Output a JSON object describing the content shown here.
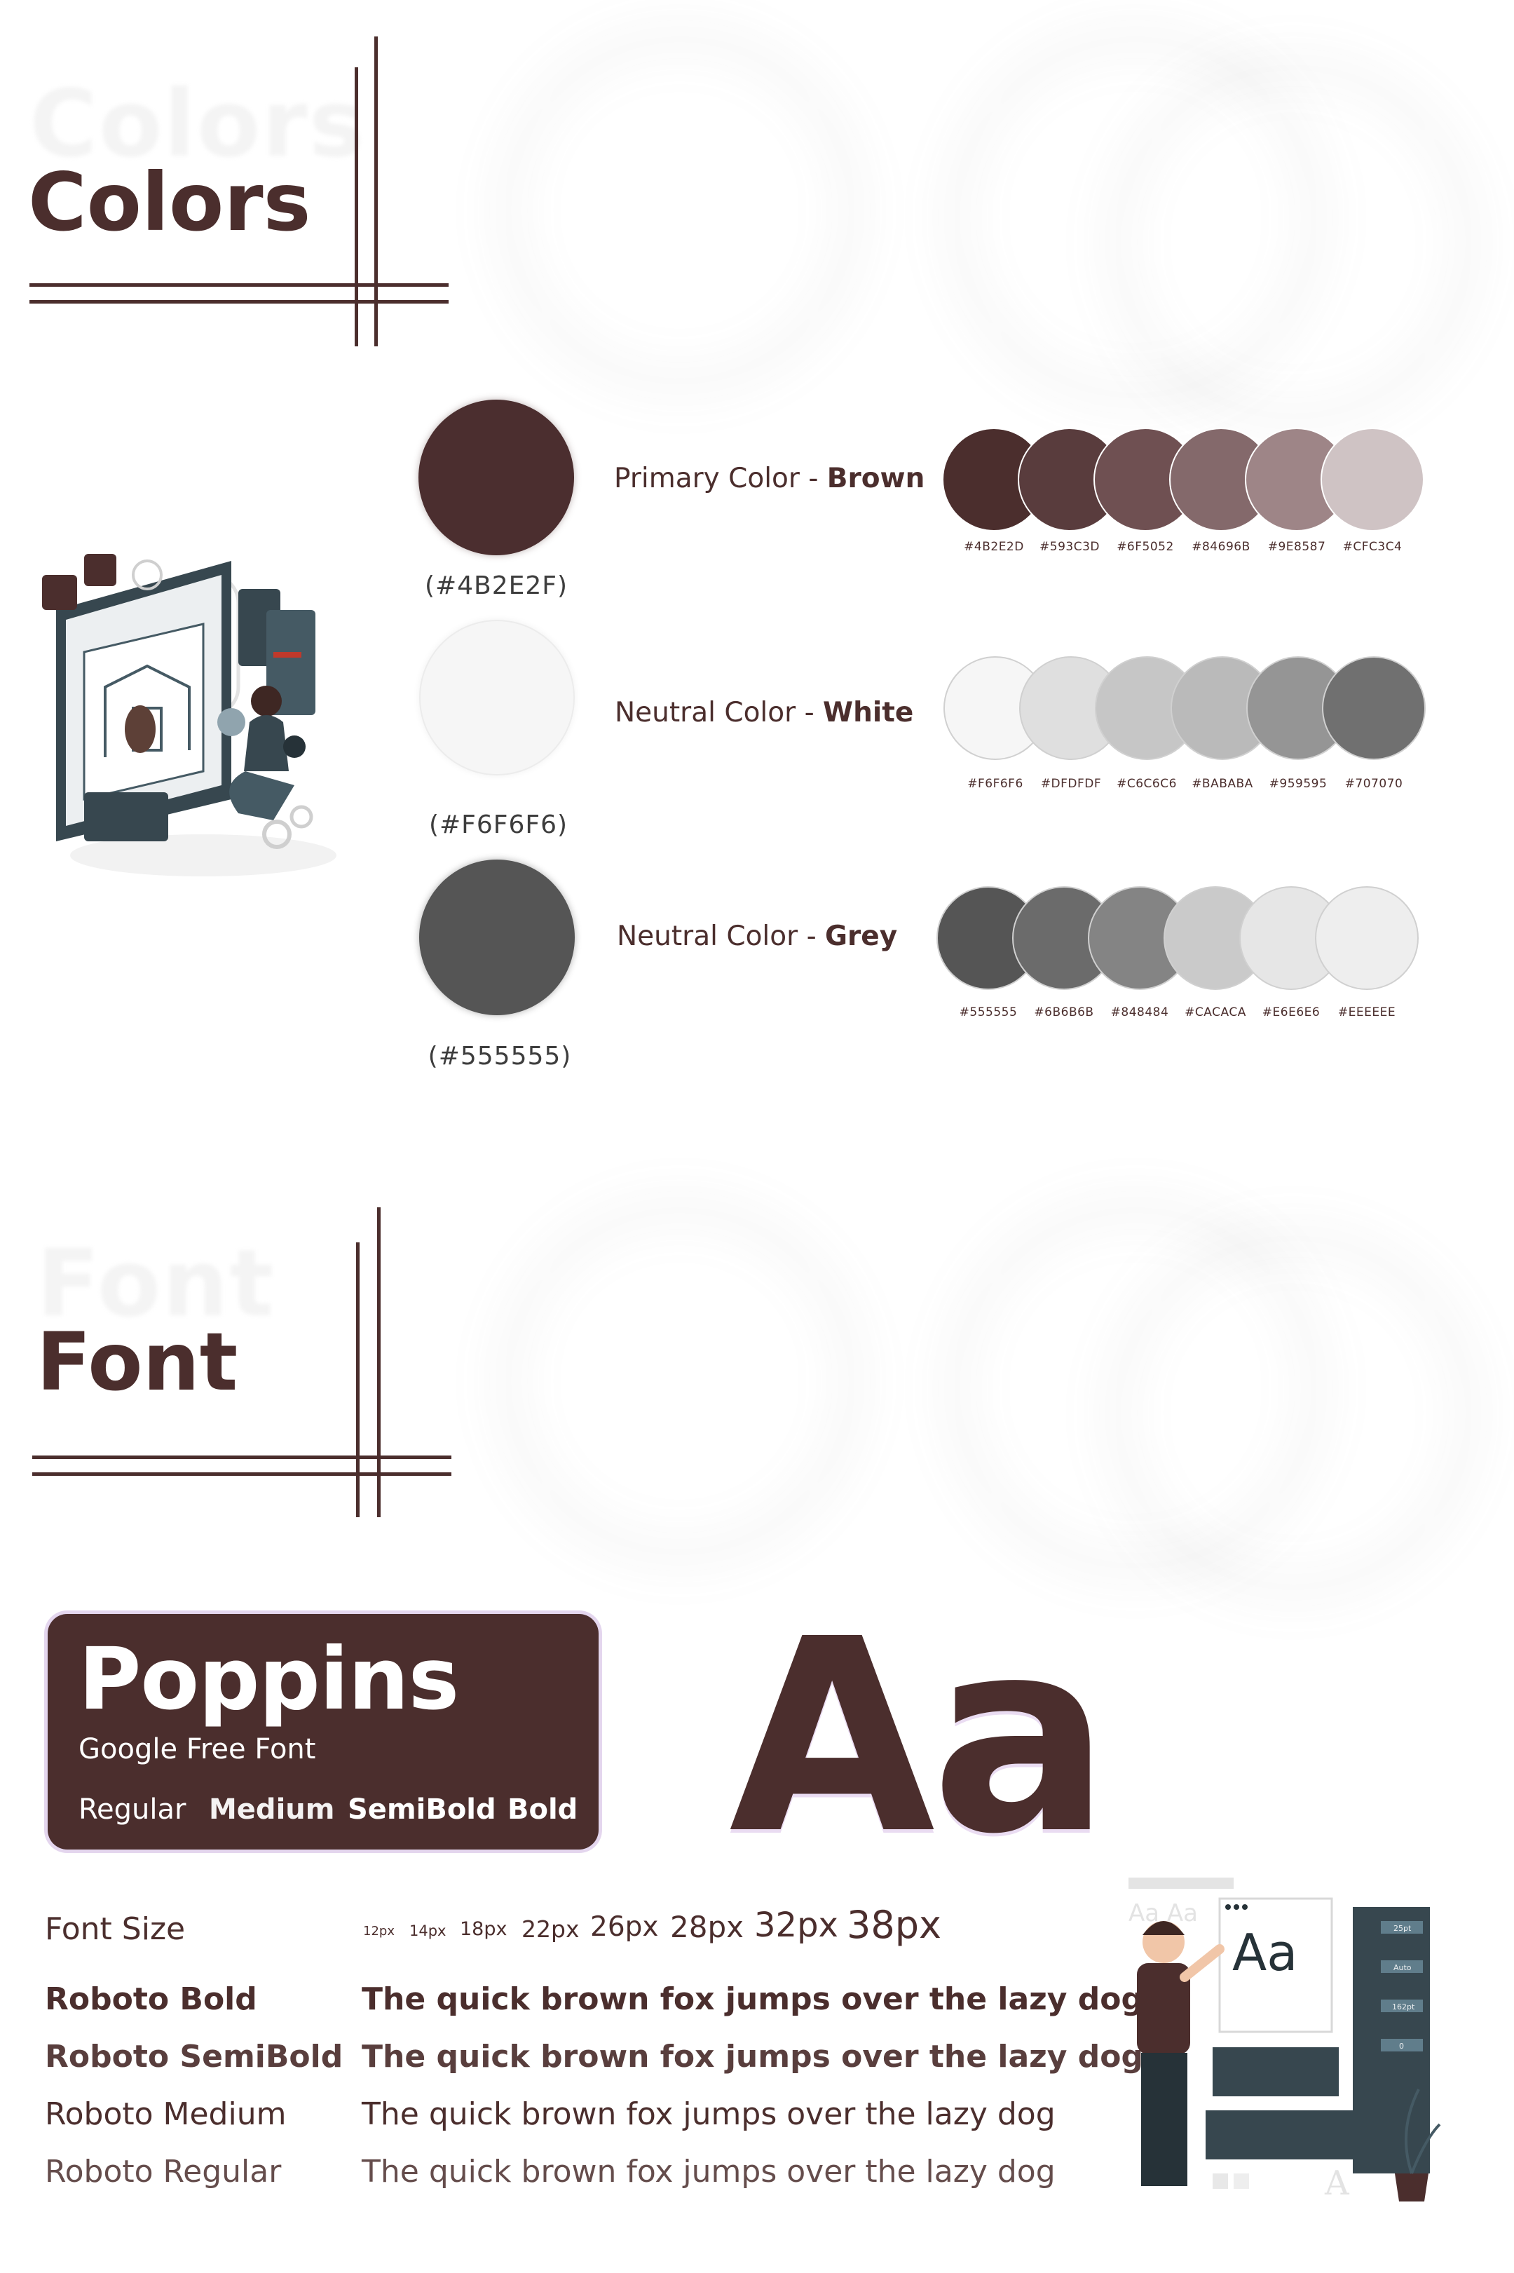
{
  "colors_section": {
    "ghost_title": "Colors",
    "title": "Colors"
  },
  "color_rows": [
    {
      "main_hex": "#4B2E2F",
      "main_code": "(#4B2E2F)",
      "label_prefix": "Primary Color - ",
      "label_name": "Brown",
      "swatches": [
        {
          "hex": "#4B2E2D",
          "code": "#4B2E2D"
        },
        {
          "hex": "#593C3D",
          "code": "#593C3D"
        },
        {
          "hex": "#6F5052",
          "code": "#6F5052"
        },
        {
          "hex": "#84696B",
          "code": "#84696B"
        },
        {
          "hex": "#9E8587",
          "code": "#9E8587"
        },
        {
          "hex": "#CFC3C4",
          "code": "#CFC3C4"
        }
      ]
    },
    {
      "main_hex": "#F6F6F6",
      "main_code": "(#F6F6F6)",
      "label_prefix": "Neutral Color - ",
      "label_name": "White",
      "swatches": [
        {
          "hex": "#F6F6F6",
          "code": "#F6F6F6"
        },
        {
          "hex": "#DFDFDF",
          "code": "#DFDFDF"
        },
        {
          "hex": "#C6C6C6",
          "code": "#C6C6C6"
        },
        {
          "hex": "#BABABA",
          "code": "#BABABA"
        },
        {
          "hex": "#959595",
          "code": "#959595"
        },
        {
          "hex": "#707070",
          "code": "#707070"
        }
      ]
    },
    {
      "main_hex": "#555555",
      "main_code": "(#555555)",
      "label_prefix": "Neutral Color - ",
      "label_name": "Grey",
      "swatches": [
        {
          "hex": "#555555",
          "code": "#555555"
        },
        {
          "hex": "#6B6B6B",
          "code": "#6B6B6B"
        },
        {
          "hex": "#848484",
          "code": "#848484"
        },
        {
          "hex": "#CACACA",
          "code": "#CACACA"
        },
        {
          "hex": "#E6E6E6",
          "code": "#E6E6E6"
        },
        {
          "hex": "#EEEEEE",
          "code": "#EEEEEE"
        }
      ]
    }
  ],
  "font_section": {
    "ghost_title": "Font",
    "title": "Font"
  },
  "font_card": {
    "name": "Poppins",
    "subtitle": "Google Free Font",
    "weights": [
      "Regular",
      "Medium",
      "SemiBold",
      "Bold"
    ]
  },
  "sample_glyph": "Aa",
  "font_size": {
    "label": "Font Size",
    "sizes": [
      "12px",
      "14px",
      "18px",
      "22px",
      "26px",
      "28px",
      "32px",
      "38px"
    ]
  },
  "font_styles": [
    {
      "name": "Roboto Bold",
      "weight": "bold",
      "sample": "The quick brown fox jumps over the lazy dog"
    },
    {
      "name": "Roboto SemiBold",
      "weight": "semibold",
      "sample": "The quick brown fox jumps over the lazy dog"
    },
    {
      "name": "Roboto Medium",
      "weight": "medium",
      "sample": "The quick brown fox jumps over the lazy dog"
    },
    {
      "name": "Roboto Regular",
      "weight": "regular",
      "sample": "The quick brown fox jumps over the lazy dog"
    }
  ],
  "illustrations": {
    "designer_glyph": "Aa",
    "designer_panel_values": [
      "25pt",
      "Auto",
      "162pt",
      "0"
    ]
  },
  "theme": {
    "brown": "#4B2E2D",
    "card_border": "#E4D6EE"
  }
}
